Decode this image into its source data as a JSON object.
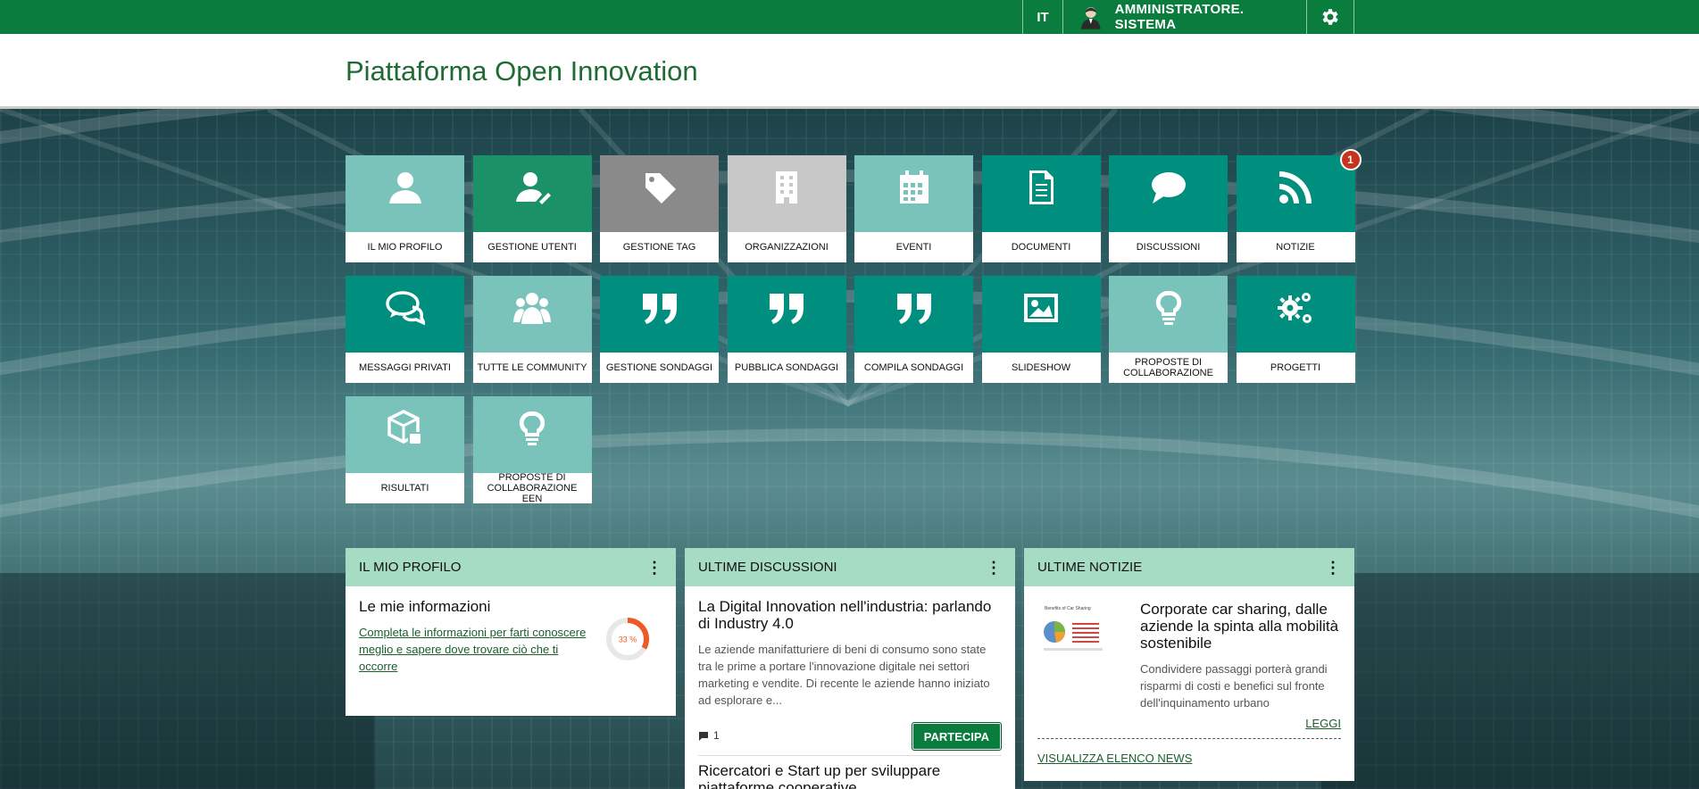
{
  "topbar": {
    "lang": "IT",
    "user_name": "AMMINISTRATORE. SISTEMA"
  },
  "header": {
    "title": "Piattaforma Open Innovation"
  },
  "tiles": [
    {
      "label": "IL MIO PROFILO",
      "icon": "user-icon",
      "color": "#79c3bb"
    },
    {
      "label": "GESTIONE UTENTI",
      "icon": "users-manage-icon",
      "color": "#1b9168"
    },
    {
      "label": "GESTIONE TAG",
      "icon": "tag-icon",
      "color": "#8a8a8a"
    },
    {
      "label": "ORGANIZZAZIONI",
      "icon": "building-icon",
      "color": "#c8c8c8"
    },
    {
      "label": "EVENTI",
      "icon": "calendar-icon",
      "color": "#79c3bb"
    },
    {
      "label": "DOCUMENTI",
      "icon": "document-icon",
      "color": "#008f7e"
    },
    {
      "label": "DISCUSSIONI",
      "icon": "speech-bubble-icon",
      "color": "#008f7e"
    },
    {
      "label": "NOTIZIE",
      "icon": "rss-icon",
      "color": "#008f7e",
      "badge": "1"
    },
    {
      "label": "MESSAGGI PRIVATI",
      "icon": "chat-bubbles-icon",
      "color": "#008f7e"
    },
    {
      "label": "TUTTE LE COMMUNITY",
      "icon": "group-icon",
      "color": "#79c3bb"
    },
    {
      "label": "GESTIONE SONDAGGI",
      "icon": "quote-icon",
      "color": "#008f7e"
    },
    {
      "label": "PUBBLICA SONDAGGI",
      "icon": "quote-icon",
      "color": "#008f7e"
    },
    {
      "label": "COMPILA SONDAGGI",
      "icon": "quote-icon",
      "color": "#008f7e"
    },
    {
      "label": "SLIDESHOW",
      "icon": "image-icon",
      "color": "#008f7e"
    },
    {
      "label": "PROPOSTE DI COLLABORAZIONE",
      "icon": "lightbulb-icon",
      "color": "#79c3bb"
    },
    {
      "label": "PROGETTI",
      "icon": "gears-icon",
      "color": "#008f7e"
    },
    {
      "label": "RISULTATI",
      "icon": "cube-icon",
      "color": "#79c3bb"
    },
    {
      "label": "PROPOSTE DI COLLABORAZIONE EEN",
      "icon": "lightbulb-icon",
      "color": "#79c3bb"
    }
  ],
  "profile_widget": {
    "title": "IL MIO PROFILO",
    "heading": "Le mie informazioni",
    "link": "Completa le informazioni per farti conoscere meglio e sapere dove trovare ciò che ti occorre",
    "progress_label": "33 %",
    "progress_value": 33
  },
  "discussions_widget": {
    "title": "ULTIME DISCUSSIONI",
    "item1_title": "La Digital Innovation nell'industria: parlando di Industry 4.0",
    "item1_text": "Le aziende manifatturiere di beni di consumo sono state tra le prime a portare l'innovazione digitale nei settori marketing e vendite. Di recente le aziende hanno iniziato ad esplorare e...",
    "item1_comments": "1",
    "participate_label": "PARTECIPA",
    "item2_title": "Ricercatori e Start up per sviluppare piattaforme cooperative"
  },
  "news_widget": {
    "title": "ULTIME NOTIZIE",
    "image_caption": "Benefits of Car Sharing",
    "item_title": "Corporate car sharing, dalle aziende la spinta alla mobilità sostenibile",
    "item_text": "Condividere passaggi porterà grandi risparmi di costi e benefici sul fronte dell'inquinamento urbano",
    "read_label": "LEGGI",
    "list_label": "VISUALIZZA ELENCO NEWS"
  }
}
